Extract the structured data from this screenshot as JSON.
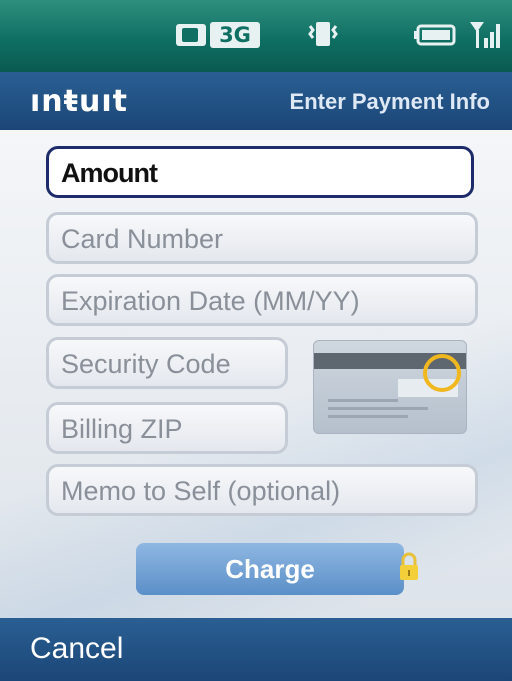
{
  "status_bar": {
    "network": "3G"
  },
  "header": {
    "logo": "ınŧuıt",
    "title": "Enter Payment Info"
  },
  "form": {
    "amount_value": "Amount",
    "card_number_placeholder": "Card Number",
    "expiration_placeholder": "Expiration Date (MM/YY)",
    "security_code_placeholder": "Security Code",
    "billing_zip_placeholder": "Billing ZIP",
    "memo_placeholder": "Memo to Self (optional)"
  },
  "actions": {
    "charge_label": "Charge",
    "cancel_label": "Cancel"
  },
  "colors": {
    "status_bar": "#0f6f63",
    "title_bar": "#1b4677",
    "active_border": "#1d2b6a",
    "charge_button": "#5b8fc8",
    "highlight": "#f1b71e"
  },
  "icons": [
    "sim-3g-icon",
    "vibrate-icon",
    "battery-icon",
    "signal-icon",
    "credit-card-icon",
    "lock-icon"
  ]
}
